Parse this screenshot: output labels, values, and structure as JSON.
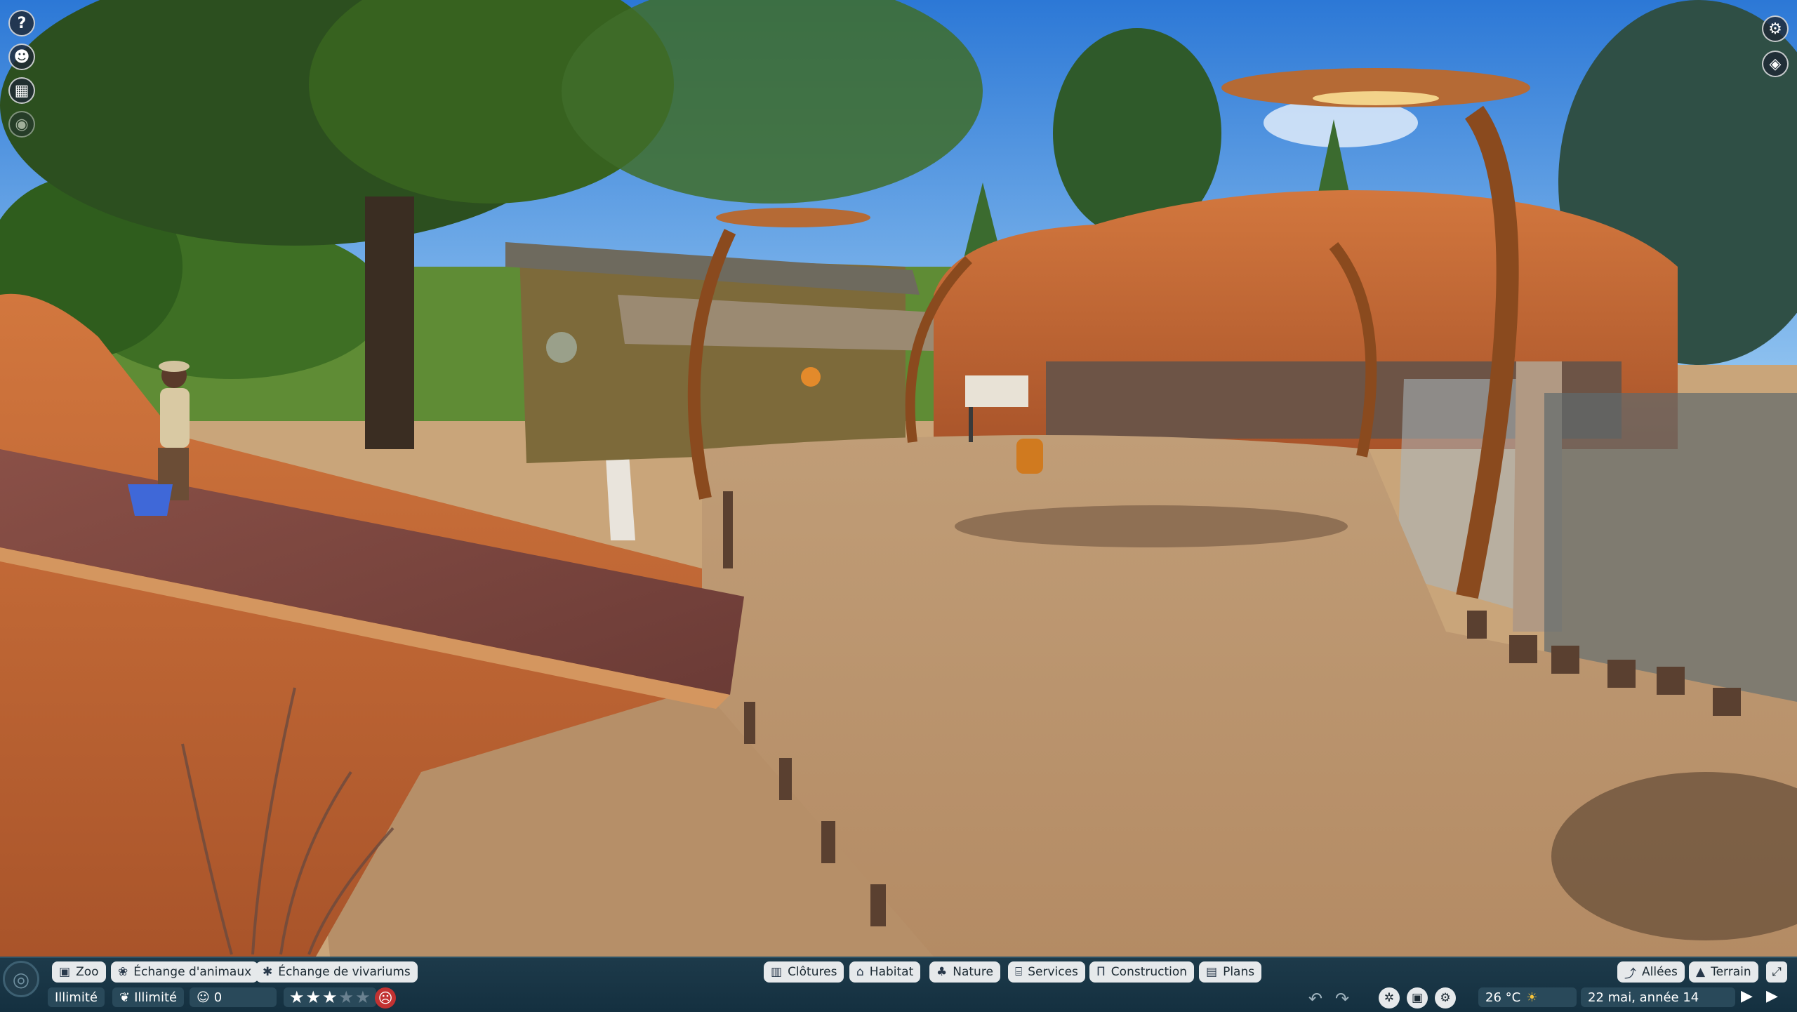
{
  "top_buttons_left": [
    {
      "name": "help-button",
      "glyph": "?"
    },
    {
      "name": "animals-button",
      "glyph": "☻"
    },
    {
      "name": "calendar-button",
      "glyph": "▦"
    },
    {
      "name": "view-button",
      "glyph": "◉"
    }
  ],
  "top_buttons_right": [
    {
      "name": "settings-button",
      "glyph": "⚙"
    },
    {
      "name": "camera-button",
      "glyph": "◈"
    }
  ],
  "bottom_bar": {
    "left_tabs": {
      "zoo": "Zoo",
      "animal_trade": "Échange d'animaux",
      "vivarium_trade": "Échange de vivariums"
    },
    "center_tabs": {
      "fences": "Clôtures",
      "habitat": "Habitat",
      "nature": "Nature",
      "services": "Services",
      "construction": "Construction",
      "plans": "Plans"
    },
    "right_tabs": {
      "paths": "Allées",
      "terrain": "Terrain"
    },
    "stats": {
      "money": "Illimité",
      "research": "Illimité",
      "guests": "0"
    },
    "rating": {
      "stars_filled": 3,
      "stars_total": 5
    },
    "temperature": "26 °C",
    "date": "22 mai, année 14"
  }
}
